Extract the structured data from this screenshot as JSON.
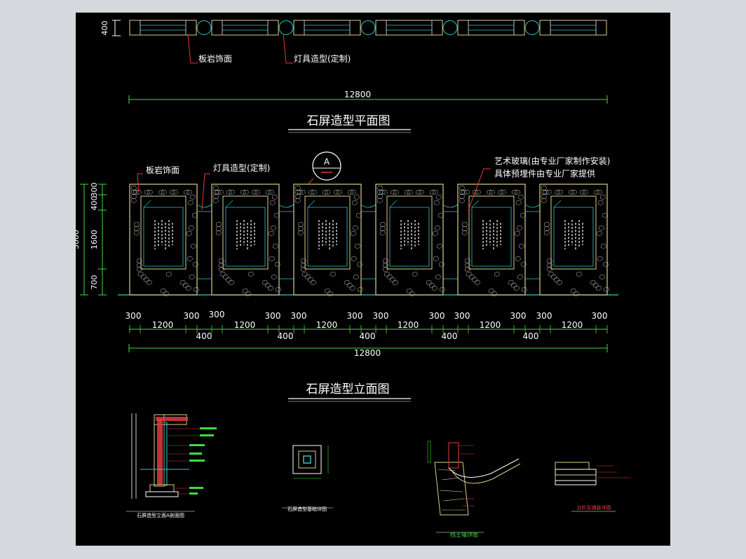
{
  "plan": {
    "height_dim": "400",
    "label_slate": "板岩饰面",
    "label_lamp": "灯具造型(定制)",
    "total_dim": "12800",
    "title": "石屏造型平面图"
  },
  "elevation": {
    "label_slate": "板岩饰面",
    "label_lamp": "灯具造型(定制)",
    "section_mark": "A",
    "label_glass_1": "艺术玻璃(由专业厂家制作安装)",
    "label_glass_2": "具体预埋件由专业厂家提供",
    "v_dims": [
      "300",
      "400",
      "1600",
      "700"
    ],
    "v_total": "3000",
    "top_dims": [
      "300",
      "300",
      "300",
      "300",
      "300",
      "300",
      "300",
      "300",
      "300",
      "300",
      "300",
      "300"
    ],
    "panel_dims": [
      "1200",
      "1200",
      "1200",
      "1200",
      "1200",
      "1200"
    ],
    "gap_dims": [
      "400",
      "400",
      "400",
      "400",
      "400"
    ],
    "total_dim": "12800",
    "title": "石屏造型立面图"
  },
  "details": {
    "d1_title": "石屏造型立面A剖面图",
    "d2_title": "石屏造型基础详图",
    "d3_title": "挡土墙详图",
    "d4_title": "台阶及铺装详图"
  },
  "colors": {
    "background": "#000000",
    "frame": "#d9ce8a",
    "dimension": "#3fdd3f",
    "leader": "#e23c3c",
    "text": "#ffffff",
    "glass": "#33c6c6"
  }
}
